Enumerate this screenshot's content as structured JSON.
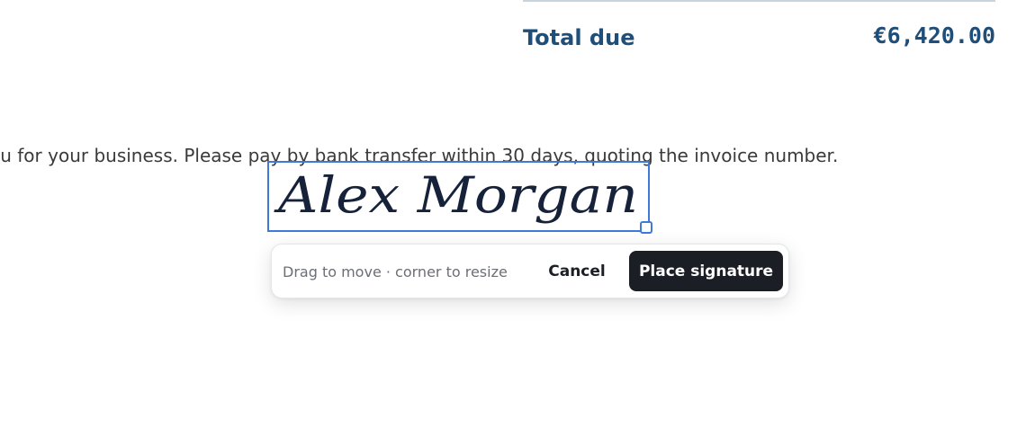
{
  "invoice": {
    "total_label": "Total due",
    "total_value": "€6,420.00",
    "note": "ou for your business. Please pay by bank transfer within 30 days, quoting the invoice number."
  },
  "signature": {
    "text": "Alex Morgan",
    "ink_color": "#16223a",
    "frame_color": "#3f7ad9"
  },
  "toolbar": {
    "hint": "Drag to move · corner to resize",
    "cancel_label": "Cancel",
    "place_label": "Place signature"
  }
}
